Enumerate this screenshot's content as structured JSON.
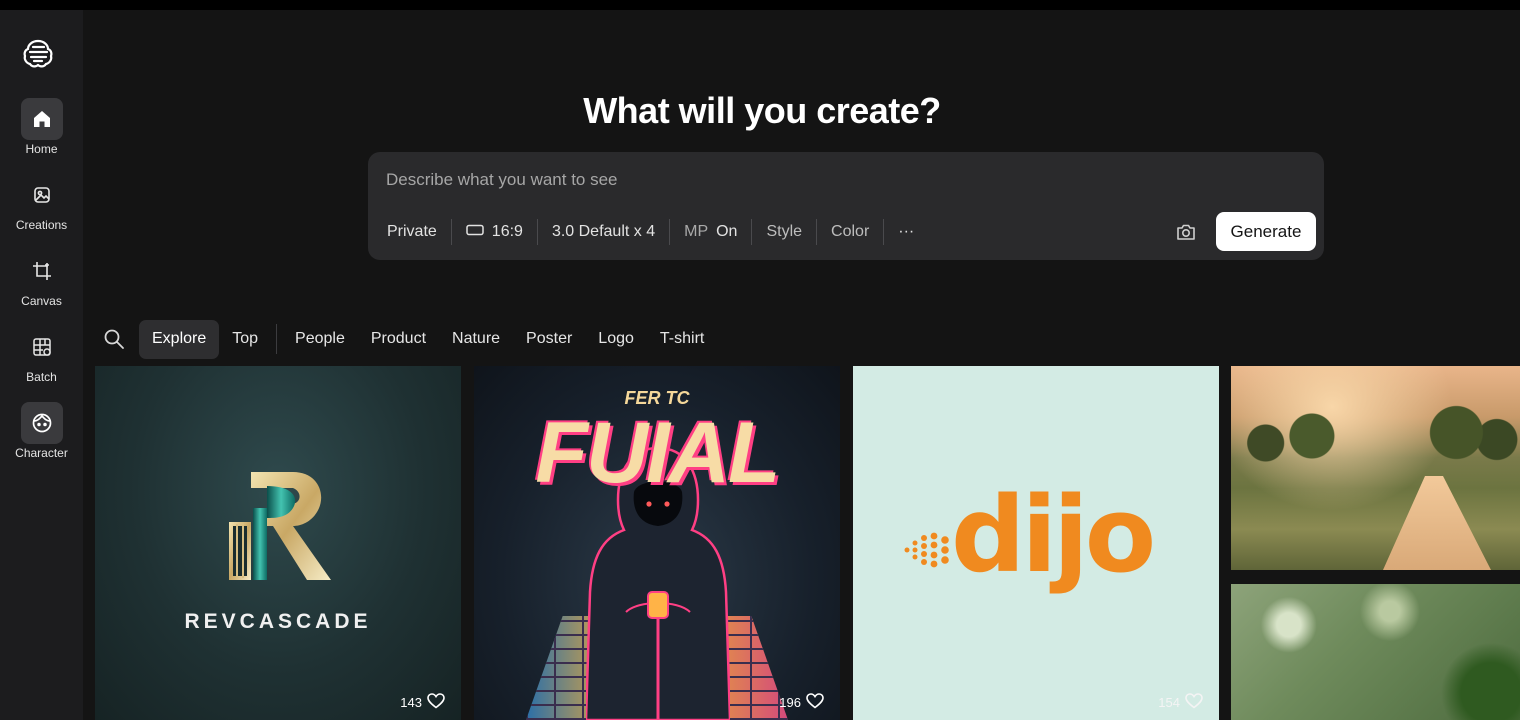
{
  "sidebar": {
    "items": [
      {
        "label": "Home",
        "icon": "home-icon"
      },
      {
        "label": "Creations",
        "icon": "image-icon"
      },
      {
        "label": "Canvas",
        "icon": "crop-icon"
      },
      {
        "label": "Batch",
        "icon": "grid-icon"
      },
      {
        "label": "Character",
        "icon": "character-face-icon"
      }
    ]
  },
  "hero": {
    "title": "What will you create?"
  },
  "prompt": {
    "placeholder": "Describe what you want to see",
    "options": {
      "visibility": "Private",
      "aspect": "16:9",
      "model": "3.0 Default x 4",
      "mp_label": "MP",
      "mp_value": "On",
      "style": "Style",
      "color": "Color",
      "more": "···"
    },
    "generate_label": "Generate"
  },
  "filters": [
    "Explore",
    "Top",
    "People",
    "Product",
    "Nature",
    "Poster",
    "Logo",
    "T-shirt"
  ],
  "gallery": {
    "cards": [
      {
        "brand": "REVCASCADE",
        "likes": "143"
      },
      {
        "top_text": "FER TC",
        "title": "FUIAL",
        "likes": "196"
      },
      {
        "brand": "dijo",
        "likes": "154"
      }
    ]
  },
  "colors": {
    "accent_orange": "#f08a1f",
    "poster_pink": "#ff3f84",
    "sidebar_bg": "#1c1c1e",
    "main_bg": "#141414"
  }
}
